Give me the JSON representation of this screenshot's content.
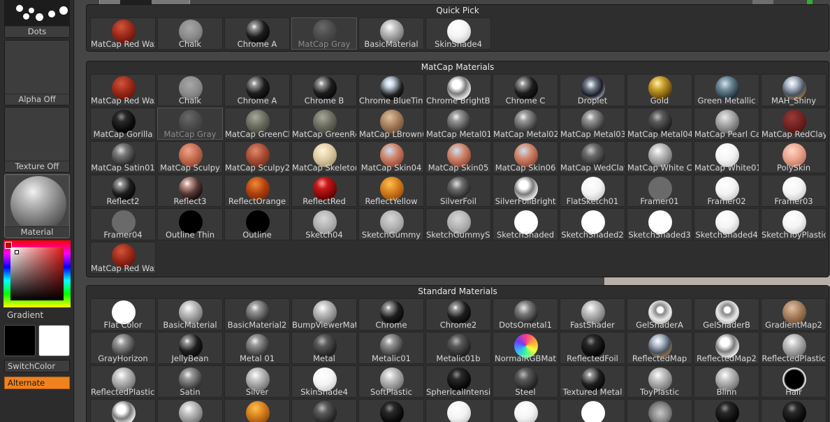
{
  "left_tray": {
    "dots_label": "Dots",
    "alpha_label": "Alpha Off",
    "texture_label": "Texture Off",
    "material_label": "Material",
    "gradient_label": "Gradient",
    "switchcolor_label": "SwitchColor",
    "alternate_label": "Alternate",
    "main_color": "#000000",
    "secondary_color": "#ffffff",
    "accent_color": "#f0821e"
  },
  "quick_pick": {
    "title": "Quick Pick",
    "items": [
      {
        "label": "MatCap Red Wax",
        "style": "red"
      },
      {
        "label": "Chalk",
        "style": "chalk"
      },
      {
        "label": "Chrome A",
        "style": "chrome"
      },
      {
        "label": "MatCap Gray",
        "style": "gray",
        "dim": true,
        "selected": true
      },
      {
        "label": "BasicMaterial",
        "style": "basic"
      },
      {
        "label": "SkinShade4",
        "style": "white"
      }
    ]
  },
  "matcap_materials": {
    "title": "MatCap Materials",
    "items": [
      {
        "label": "MatCap Red Wax",
        "style": "red"
      },
      {
        "label": "Chalk",
        "style": "chalk"
      },
      {
        "label": "Chrome A",
        "style": "chrome"
      },
      {
        "label": "Chrome B",
        "style": "chrome"
      },
      {
        "label": "Chrome BlueTint",
        "style": "chromeblue"
      },
      {
        "label": "Chrome BrightBl",
        "style": "chromebright"
      },
      {
        "label": "Chrome C",
        "style": "chrome"
      },
      {
        "label": "Droplet",
        "style": "droplet"
      },
      {
        "label": "Gold",
        "style": "gold"
      },
      {
        "label": "Green Metallic",
        "style": "greenmetal"
      },
      {
        "label": "MAH_Shiny",
        "style": "shiny"
      },
      {
        "label": "MatCap Gorilla",
        "style": "black"
      },
      {
        "label": "MatCap Gray",
        "style": "gray",
        "dim": true,
        "selected": true
      },
      {
        "label": "MatCap GreenCl",
        "style": "greenclay"
      },
      {
        "label": "MatCap GreenRc",
        "style": "greenclay"
      },
      {
        "label": "MatCap LBrown(",
        "style": "lbrown"
      },
      {
        "label": "MatCap Metal01",
        "style": "metal"
      },
      {
        "label": "MatCap Metal02",
        "style": "metal"
      },
      {
        "label": "MatCap Metal03",
        "style": "metal"
      },
      {
        "label": "MatCap Metal04",
        "style": "dark"
      },
      {
        "label": "MatCap Pearl Ca",
        "style": "pearl"
      },
      {
        "label": "MatCap RedClay",
        "style": "redclay"
      },
      {
        "label": "MatCap Satin01",
        "style": "satin"
      },
      {
        "label": "MatCap Sculpy",
        "style": "sculpy"
      },
      {
        "label": "MatCap Sculpy2",
        "style": "sculpy2"
      },
      {
        "label": "MatCap Skeleton",
        "style": "skeleton"
      },
      {
        "label": "MatCap Skin04",
        "style": "skin"
      },
      {
        "label": "MatCap Skin05",
        "style": "skin"
      },
      {
        "label": "MatCap Skin06",
        "style": "skin"
      },
      {
        "label": "MatCap WedClay",
        "style": "wedclay"
      },
      {
        "label": "MatCap White Ca",
        "style": "basic"
      },
      {
        "label": "MatCap White01",
        "style": "white"
      },
      {
        "label": "PolySkin",
        "style": "polyskin"
      },
      {
        "label": "Reflect2",
        "style": "chrome"
      },
      {
        "label": "Reflect3",
        "style": "reflect3"
      },
      {
        "label": "ReflectOrange",
        "style": "orange"
      },
      {
        "label": "ReflectRed",
        "style": "reflectred"
      },
      {
        "label": "ReflectYellow",
        "style": "yellow"
      },
      {
        "label": "SilverFoil",
        "style": "silverfoil"
      },
      {
        "label": "SilverFoilBright",
        "style": "chromebright"
      },
      {
        "label": "FlatSketch01",
        "style": "white"
      },
      {
        "label": "Framer01",
        "style": "framer"
      },
      {
        "label": "Framer02",
        "style": "white"
      },
      {
        "label": "Framer03",
        "style": "white"
      },
      {
        "label": "Framer04",
        "style": "framer"
      },
      {
        "label": "Outline Thin",
        "style": "outlinethin"
      },
      {
        "label": "Outline",
        "style": "outline"
      },
      {
        "label": "Sketch04",
        "style": "sketch"
      },
      {
        "label": "SketchGummy",
        "style": "sketch"
      },
      {
        "label": "SketchGummySh",
        "style": "sketch"
      },
      {
        "label": "SketchShaded",
        "style": "flatwhite"
      },
      {
        "label": "SketchShaded2",
        "style": "flatwhite"
      },
      {
        "label": "SketchShaded3",
        "style": "flatwhite"
      },
      {
        "label": "SketchShaded4",
        "style": "white"
      },
      {
        "label": "SketchToyPlastic",
        "style": "white"
      },
      {
        "label": "MatCap Red Wax",
        "style": "red"
      }
    ]
  },
  "standard_materials": {
    "title": "Standard Materials",
    "items": [
      {
        "label": "Flat Color",
        "style": "flatwhite"
      },
      {
        "label": "BasicMaterial",
        "style": "basic"
      },
      {
        "label": "BasicMaterial2",
        "style": "metal"
      },
      {
        "label": "BumpViewerMat",
        "style": "basic"
      },
      {
        "label": "Chrome",
        "style": "chrome"
      },
      {
        "label": "Chrome2",
        "style": "chrome"
      },
      {
        "label": "DotsOmetal1",
        "style": "dots"
      },
      {
        "label": "FastShader",
        "style": "basic"
      },
      {
        "label": "GelShaderA",
        "style": "gel"
      },
      {
        "label": "GelShaderB",
        "style": "gel"
      },
      {
        "label": "GradientMap2",
        "style": "lbrown"
      },
      {
        "label": "GrayHorizon",
        "style": "metal"
      },
      {
        "label": "JellyBean",
        "style": "chrome"
      },
      {
        "label": "Metal 01",
        "style": "metal"
      },
      {
        "label": "Metal",
        "style": "dark"
      },
      {
        "label": "Metalic01",
        "style": "metal"
      },
      {
        "label": "Metalic01b",
        "style": "dark"
      },
      {
        "label": "NormalRGBMat",
        "style": "normal"
      },
      {
        "label": "ReflectedFoil",
        "style": "black"
      },
      {
        "label": "ReflectedMap",
        "style": "shiny"
      },
      {
        "label": "ReflectedMap2",
        "style": "chromebright"
      },
      {
        "label": "ReflectedPlastic",
        "style": "basic"
      },
      {
        "label": "ReflectedPlasticE",
        "style": "basic"
      },
      {
        "label": "Satin",
        "style": "metal"
      },
      {
        "label": "Silver",
        "style": "basic"
      },
      {
        "label": "SkinShade4",
        "style": "white"
      },
      {
        "label": "SoftPlastic",
        "style": "basic"
      },
      {
        "label": "SphericalIntensit",
        "style": "black"
      },
      {
        "label": "Steel",
        "style": "dark"
      },
      {
        "label": "Textured Metal",
        "style": "chrome"
      },
      {
        "label": "ToyPlastic",
        "style": "basic"
      },
      {
        "label": "Blinn",
        "style": "basic"
      },
      {
        "label": "Hair",
        "style": "hair"
      },
      {
        "label": "",
        "style": "chromebright"
      },
      {
        "label": "",
        "style": "basic"
      },
      {
        "label": "",
        "style": "yellow"
      },
      {
        "label": "",
        "style": "dark"
      },
      {
        "label": "",
        "style": "black"
      },
      {
        "label": "",
        "style": "white"
      },
      {
        "label": "",
        "style": "white"
      },
      {
        "label": "",
        "style": "flatwhite"
      },
      {
        "label": "",
        "style": "fur"
      },
      {
        "label": "",
        "style": "black"
      },
      {
        "label": "",
        "style": "black"
      }
    ]
  }
}
